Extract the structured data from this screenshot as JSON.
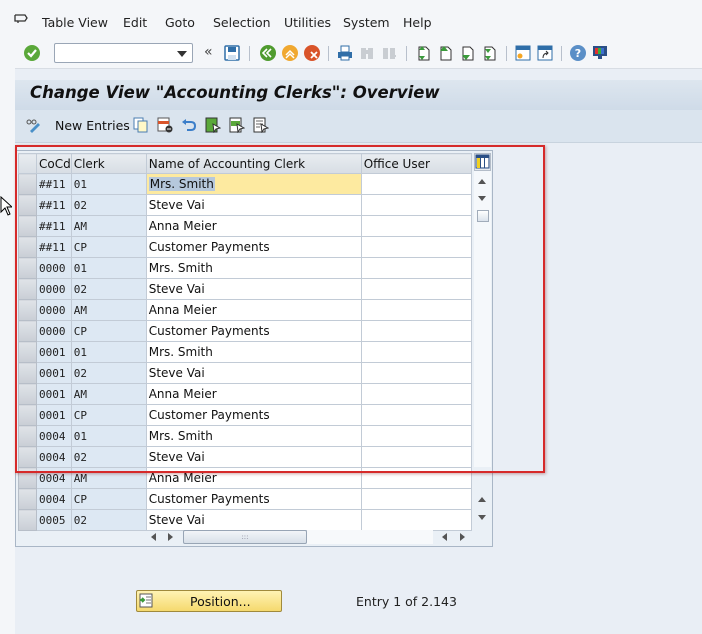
{
  "menubar": {
    "items": [
      "Table View",
      "Edit",
      "Goto",
      "Selection",
      "Utilities",
      "System",
      "Help"
    ]
  },
  "toolbar": {
    "command_field_value": "",
    "icons": [
      "enter-check-icon",
      "command-dropdown",
      "collapse-icon",
      "save-icon",
      "back-icon",
      "exit-icon",
      "cancel-icon",
      "print-icon",
      "find-icon",
      "find-next-icon",
      "first-page-icon",
      "previous-page-icon",
      "next-page-icon",
      "last-page-icon",
      "create-session-icon",
      "create-shortcut-icon",
      "help-icon",
      "customize-layout-icon"
    ]
  },
  "title": "Change View \"Accounting Clerks\": Overview",
  "app_toolbar": {
    "new_entries_label": "New Entries",
    "icons": [
      "display-change-icon",
      "copy-as-icon",
      "delete-icon",
      "undo-change-icon",
      "select-all-icon",
      "select-block-icon",
      "deselect-all-icon"
    ]
  },
  "table": {
    "columns": [
      "CoCd",
      "Clerk",
      "Name of Accounting Clerk",
      "Office User"
    ],
    "rows": [
      {
        "cocd": "##11",
        "clerk": "01",
        "name": "Mrs. Smith",
        "office_user": ""
      },
      {
        "cocd": "##11",
        "clerk": "02",
        "name": "Steve Vai",
        "office_user": ""
      },
      {
        "cocd": "##11",
        "clerk": "AM",
        "name": "Anna Meier",
        "office_user": ""
      },
      {
        "cocd": "##11",
        "clerk": "CP",
        "name": "Customer Payments",
        "office_user": ""
      },
      {
        "cocd": "0000",
        "clerk": "01",
        "name": "Mrs. Smith",
        "office_user": ""
      },
      {
        "cocd": "0000",
        "clerk": "02",
        "name": "Steve Vai",
        "office_user": ""
      },
      {
        "cocd": "0000",
        "clerk": "AM",
        "name": "Anna Meier",
        "office_user": ""
      },
      {
        "cocd": "0000",
        "clerk": "CP",
        "name": "Customer Payments",
        "office_user": ""
      },
      {
        "cocd": "0001",
        "clerk": "01",
        "name": "Mrs. Smith",
        "office_user": ""
      },
      {
        "cocd": "0001",
        "clerk": "02",
        "name": "Steve Vai",
        "office_user": ""
      },
      {
        "cocd": "0001",
        "clerk": "AM",
        "name": "Anna Meier",
        "office_user": ""
      },
      {
        "cocd": "0001",
        "clerk": "CP",
        "name": "Customer Payments",
        "office_user": ""
      },
      {
        "cocd": "0004",
        "clerk": "01",
        "name": "Mrs. Smith",
        "office_user": ""
      },
      {
        "cocd": "0004",
        "clerk": "02",
        "name": "Steve Vai",
        "office_user": ""
      },
      {
        "cocd": "0004",
        "clerk": "AM",
        "name": "Anna Meier",
        "office_user": ""
      },
      {
        "cocd": "0004",
        "clerk": "CP",
        "name": "Customer Payments",
        "office_user": ""
      },
      {
        "cocd": "0005",
        "clerk": "02",
        "name": "Steve Vai",
        "office_user": ""
      }
    ],
    "focused_row": 0
  },
  "footer": {
    "position_button_label": "Position...",
    "entry_info": "Entry 1 of 2.143"
  },
  "colors": {
    "highlight_border": "#d62a2a",
    "focused_cell": "#fdeaa0",
    "key_column_bg": "#dde8f3",
    "position_button": "#f5d96e"
  }
}
